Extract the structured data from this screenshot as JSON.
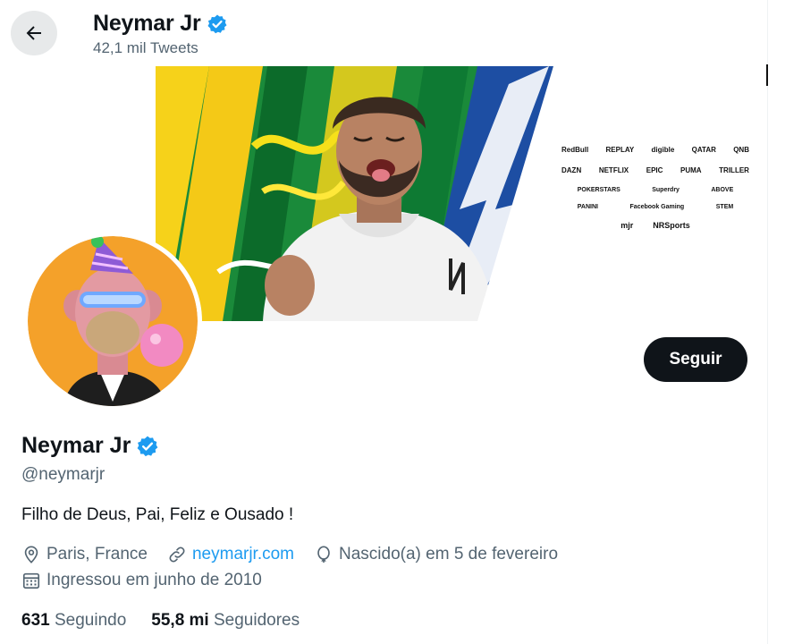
{
  "header": {
    "back_icon": "arrow-left-icon",
    "name": "Neymar Jr",
    "verified_icon": "verified-badge-icon",
    "tweets_count": "42,1 mil Tweets"
  },
  "banner": {
    "sponsors": [
      [
        "RedBull",
        "REPLAY",
        "digible",
        "QATAR",
        "QNB"
      ],
      [
        "DAZN",
        "NETFLIX",
        "EPIC",
        "PUMA",
        "TRILLER"
      ],
      [
        "POKERSTARS",
        "Superdry",
        "ABOVE"
      ],
      [
        "PANINI",
        "Facebook Gaming",
        "STEM"
      ],
      [
        "mjr",
        "NRSports"
      ]
    ]
  },
  "profile": {
    "name": "Neymar Jr",
    "handle": "@neymarjr",
    "bio": "Filho de Deus, Pai, Feliz e Ousado !",
    "location": "Paris, France",
    "website": "neymarjr.com",
    "birthday": "Nascido(a) em 5 de fevereiro",
    "joined": "Ingressou em junho de 2010",
    "following_count": "631",
    "following_label": "Seguindo",
    "followers_count": "55,8 mi",
    "followers_label": "Seguidores"
  },
  "actions": {
    "follow_label": "Seguir"
  },
  "colors": {
    "accent": "#1d9bf0",
    "text": "#0f1419",
    "secondary": "#536471",
    "avatar_bg": "#f4a12a"
  }
}
